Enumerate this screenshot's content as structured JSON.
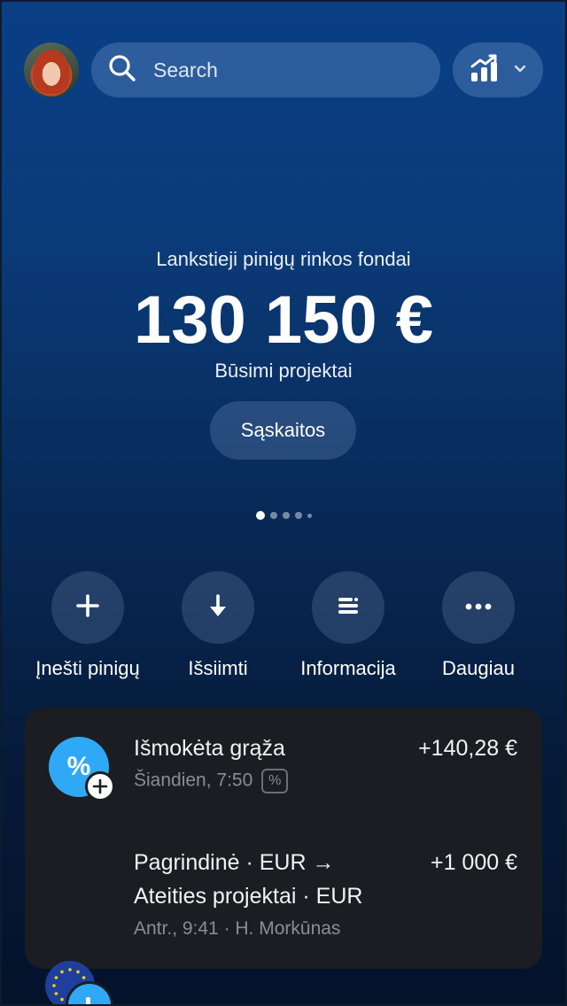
{
  "header": {
    "search_placeholder": "Search",
    "avatar": "user-avatar",
    "stats_icon": "bar-chart-growth-icon",
    "dropdown_icon": "chevron-down-icon"
  },
  "balance": {
    "title": "Lankstieji pinigų rinkos fondai",
    "amount": "130 150 €",
    "label": "Būsimi projektai",
    "accounts_button": "Sąskaitos"
  },
  "pager": {
    "count": 5,
    "active": 1
  },
  "actions": [
    {
      "label": "Įnešti pinigų",
      "icon": "plus-icon"
    },
    {
      "label": "Išsiimti",
      "icon": "arrow-down-icon"
    },
    {
      "label": "Informacija",
      "icon": "info-list-icon"
    },
    {
      "label": "Daugiau",
      "icon": "more-dots-icon"
    }
  ],
  "transactions": [
    {
      "title": "Išmokėta grąža",
      "subtitle": "Šiandien, 7:50",
      "amount": "+140,28 €",
      "icon": "percent-icon",
      "badge": "%"
    },
    {
      "title_line1": "Pagrindinė · EUR →",
      "title_line2": "Ateities projektai · EUR",
      "subtitle": "Antr., 9:41 · H. Morkūnas",
      "amount": "+1 000 €",
      "icon": "eu-flag-icon"
    }
  ],
  "colors": {
    "accent_blue": "#2fa9f5",
    "card_bg": "#1b1d22",
    "bg_top": "#0a3f86",
    "bg_bottom": "#04122a"
  }
}
